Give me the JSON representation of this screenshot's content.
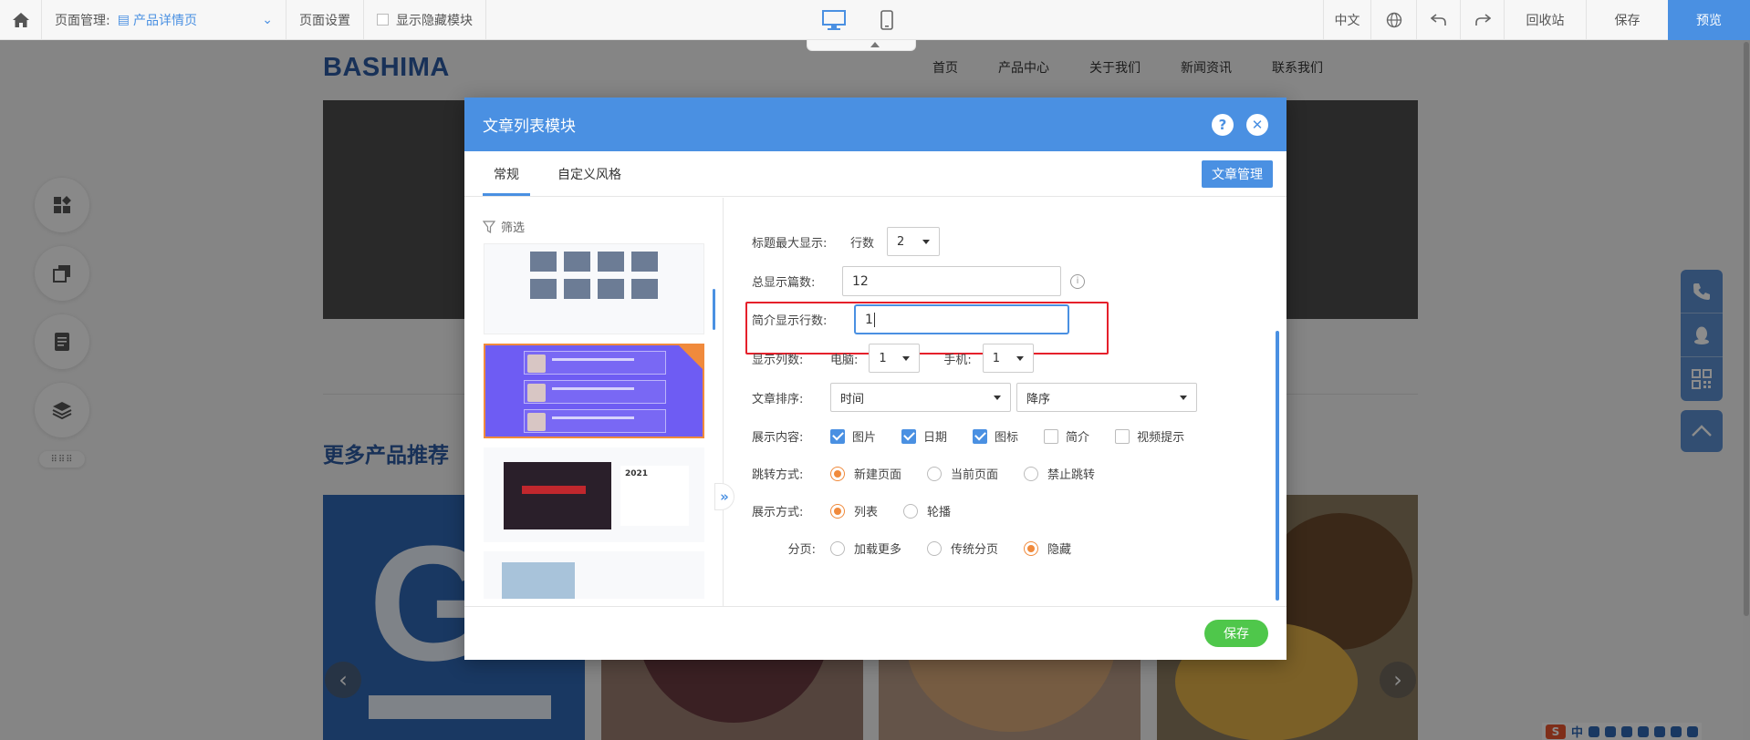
{
  "toolbar": {
    "page_manage_label": "页面管理:",
    "page_manage_value": "产品详情页",
    "page_settings": "页面设置",
    "show_hidden_modules": "显示隐藏模块",
    "lang": "中文",
    "recycle": "回收站",
    "save": "保存",
    "preview": "预览"
  },
  "site": {
    "logo": "BASHIMA",
    "nav": [
      "首页",
      "产品中心",
      "关于我们",
      "新闻资讯",
      "联系我们"
    ],
    "section_title": "更多产品推荐",
    "product1_mark": "GM"
  },
  "modal": {
    "title": "文章列表模块",
    "help": "?",
    "close": "✕",
    "tabs": [
      "常规",
      "自定义风格"
    ],
    "manage_button": "文章管理",
    "filter_label": "筛选",
    "template3_year": "2021",
    "expand": "»",
    "fields": {
      "title_max_label": "标题最大显示:",
      "title_rows_label": "行数",
      "title_rows_value": "2",
      "total_label": "总显示篇数:",
      "total_value": "12",
      "intro_rows_label": "简介显示行数:",
      "intro_rows_value": "1",
      "columns_label": "显示列数:",
      "pc_label": "电脑:",
      "pc_value": "1",
      "mobile_label": "手机:",
      "mobile_value": "1",
      "sort_label": "文章排序:",
      "sort_by": "时间",
      "sort_order": "降序",
      "content_label": "展示内容:",
      "content_options": [
        {
          "label": "图片",
          "checked": true
        },
        {
          "label": "日期",
          "checked": true
        },
        {
          "label": "图标",
          "checked": true
        },
        {
          "label": "简介",
          "checked": false
        },
        {
          "label": "视频提示",
          "checked": false
        }
      ],
      "jump_label": "跳转方式:",
      "jump_options": [
        {
          "label": "新建页面",
          "selected": true
        },
        {
          "label": "当前页面",
          "selected": false
        },
        {
          "label": "禁止跳转",
          "selected": false
        }
      ],
      "display_label": "展示方式:",
      "display_options": [
        {
          "label": "列表",
          "selected": true
        },
        {
          "label": "轮播",
          "selected": false
        }
      ],
      "paging_label": "分页:",
      "paging_options": [
        {
          "label": "加载更多",
          "selected": false
        },
        {
          "label": "传统分页",
          "selected": false
        },
        {
          "label": "隐藏",
          "selected": true
        }
      ]
    },
    "save": "保存"
  },
  "ime": {
    "brand": "S",
    "lang": "中"
  },
  "colors": {
    "accent": "#4a90e2",
    "save_green": "#4fc74b",
    "selected_orange": "#f08a3c",
    "highlight_red": "#e5202b"
  }
}
